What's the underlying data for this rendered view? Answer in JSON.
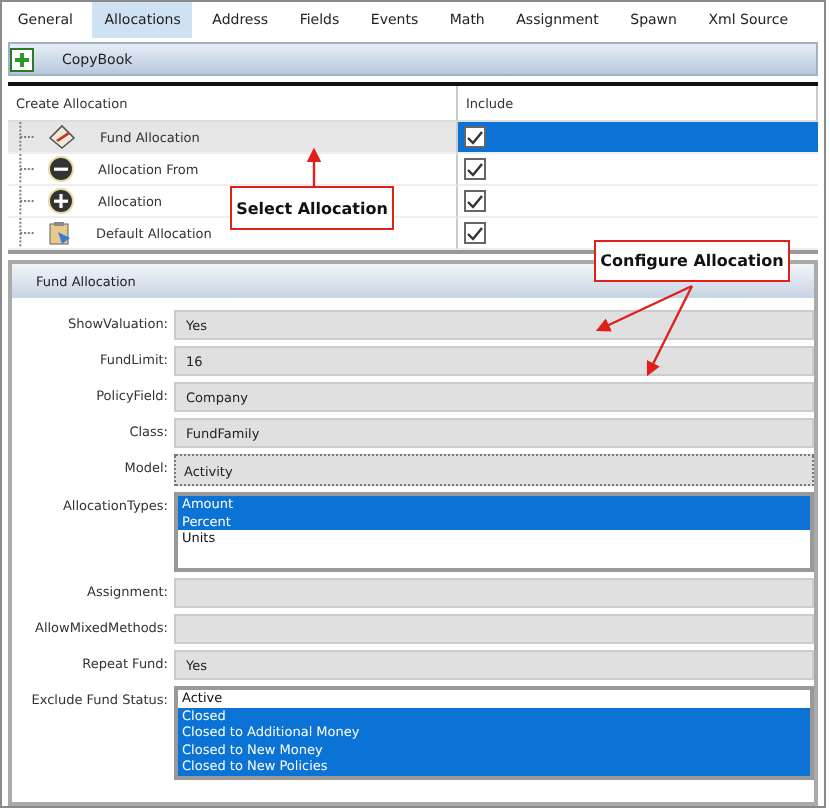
{
  "tabs": [
    {
      "label": "General",
      "selected": false
    },
    {
      "label": "Allocations",
      "selected": true
    },
    {
      "label": "Address",
      "selected": false
    },
    {
      "label": "Fields",
      "selected": false
    },
    {
      "label": "Events",
      "selected": false
    },
    {
      "label": "Math",
      "selected": false
    },
    {
      "label": "Assignment",
      "selected": false
    },
    {
      "label": "Spawn",
      "selected": false
    },
    {
      "label": "Xml Source",
      "selected": false
    }
  ],
  "toolbar": {
    "button": "CopyBook"
  },
  "tree": {
    "columns": [
      "Create Allocation",
      "Include"
    ],
    "rows": [
      {
        "label": "Fund Allocation",
        "kind": "fund",
        "included": true,
        "selected": true
      },
      {
        "label": "Allocation From",
        "kind": "minus",
        "included": true,
        "selected": false
      },
      {
        "label": "Allocation",
        "kind": "plus",
        "included": true,
        "selected": false
      },
      {
        "label": "Default Allocation",
        "kind": "default",
        "included": true,
        "selected": false
      }
    ]
  },
  "panel": {
    "title": "Fund Allocation",
    "fields": [
      {
        "label": "ShowValuation:",
        "kind": "text",
        "value": "Yes"
      },
      {
        "label": "FundLimit:",
        "kind": "text",
        "value": "16"
      },
      {
        "label": "PolicyField:",
        "kind": "text",
        "value": "Company"
      },
      {
        "label": "Class:",
        "kind": "text",
        "value": "FundFamily"
      },
      {
        "label": "Model:",
        "kind": "dotted",
        "value": "Activity"
      },
      {
        "label": "AllocationTypes:",
        "kind": "list",
        "items": [
          {
            "label": "Amount",
            "selected": true
          },
          {
            "label": "Percent",
            "selected": true
          },
          {
            "label": "Units",
            "selected": false
          }
        ]
      },
      {
        "label": "Assignment:",
        "kind": "text"
      },
      {
        "label": "AllowMixedMethods:",
        "kind": "text"
      },
      {
        "label": "Repeat Fund:",
        "kind": "text",
        "value": "Yes"
      },
      {
        "label": "Exclude Fund Status:",
        "kind": "list",
        "items": [
          {
            "label": "Active",
            "selected": false
          },
          {
            "label": "Closed",
            "selected": true
          },
          {
            "label": "Closed to Additional Money",
            "selected": true
          },
          {
            "label": "Closed to New Money",
            "selected": true
          },
          {
            "label": "Closed to New Policies",
            "selected": true
          }
        ]
      }
    ]
  },
  "annotations": [
    "Select Allocation",
    "Configure Allocation"
  ]
}
